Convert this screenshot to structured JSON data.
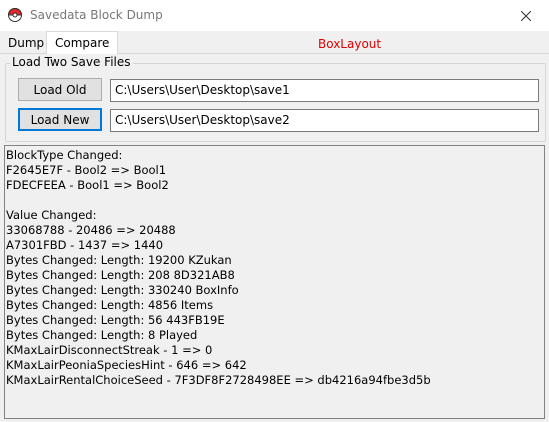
{
  "window": {
    "title": "Savedata Block Dump",
    "close_icon": "close-icon",
    "app_icon": "pokeball-icon"
  },
  "tabs": [
    {
      "label": "Dump"
    },
    {
      "label": "Compare"
    }
  ],
  "header": {
    "layout_label": "BoxLayout"
  },
  "load_group": {
    "title": "Load Two Save Files",
    "old_button": "Load Old",
    "new_button": "Load New",
    "old_path": "C:\\Users\\User\\Desktop\\save1",
    "new_path": "C:\\Users\\User\\Desktop\\save2"
  },
  "results": {
    "lines": [
      "BlockType Changed:",
      "F2645E7F - Bool2 => Bool1",
      "FDECFEEA - Bool1 => Bool2",
      "",
      "Value Changed:",
      "33068788 - 20486 => 20488",
      "A7301FBD - 1437 => 1440",
      "Bytes Changed: Length: 19200 KZukan",
      "Bytes Changed: Length: 208 8D321AB8",
      "Bytes Changed: Length: 330240 BoxInfo",
      "Bytes Changed: Length: 4856 Items",
      "Bytes Changed: Length: 56 443FB19E",
      "Bytes Changed: Length: 8 Played",
      "KMaxLairDisconnectStreak - 1 => 0",
      "KMaxLairPeoniaSpeciesHint - 646 => 642",
      "KMaxLairRentalChoiceSeed - 7F3DF8F2728498EE => db4216a94fbe3d5b"
    ]
  }
}
